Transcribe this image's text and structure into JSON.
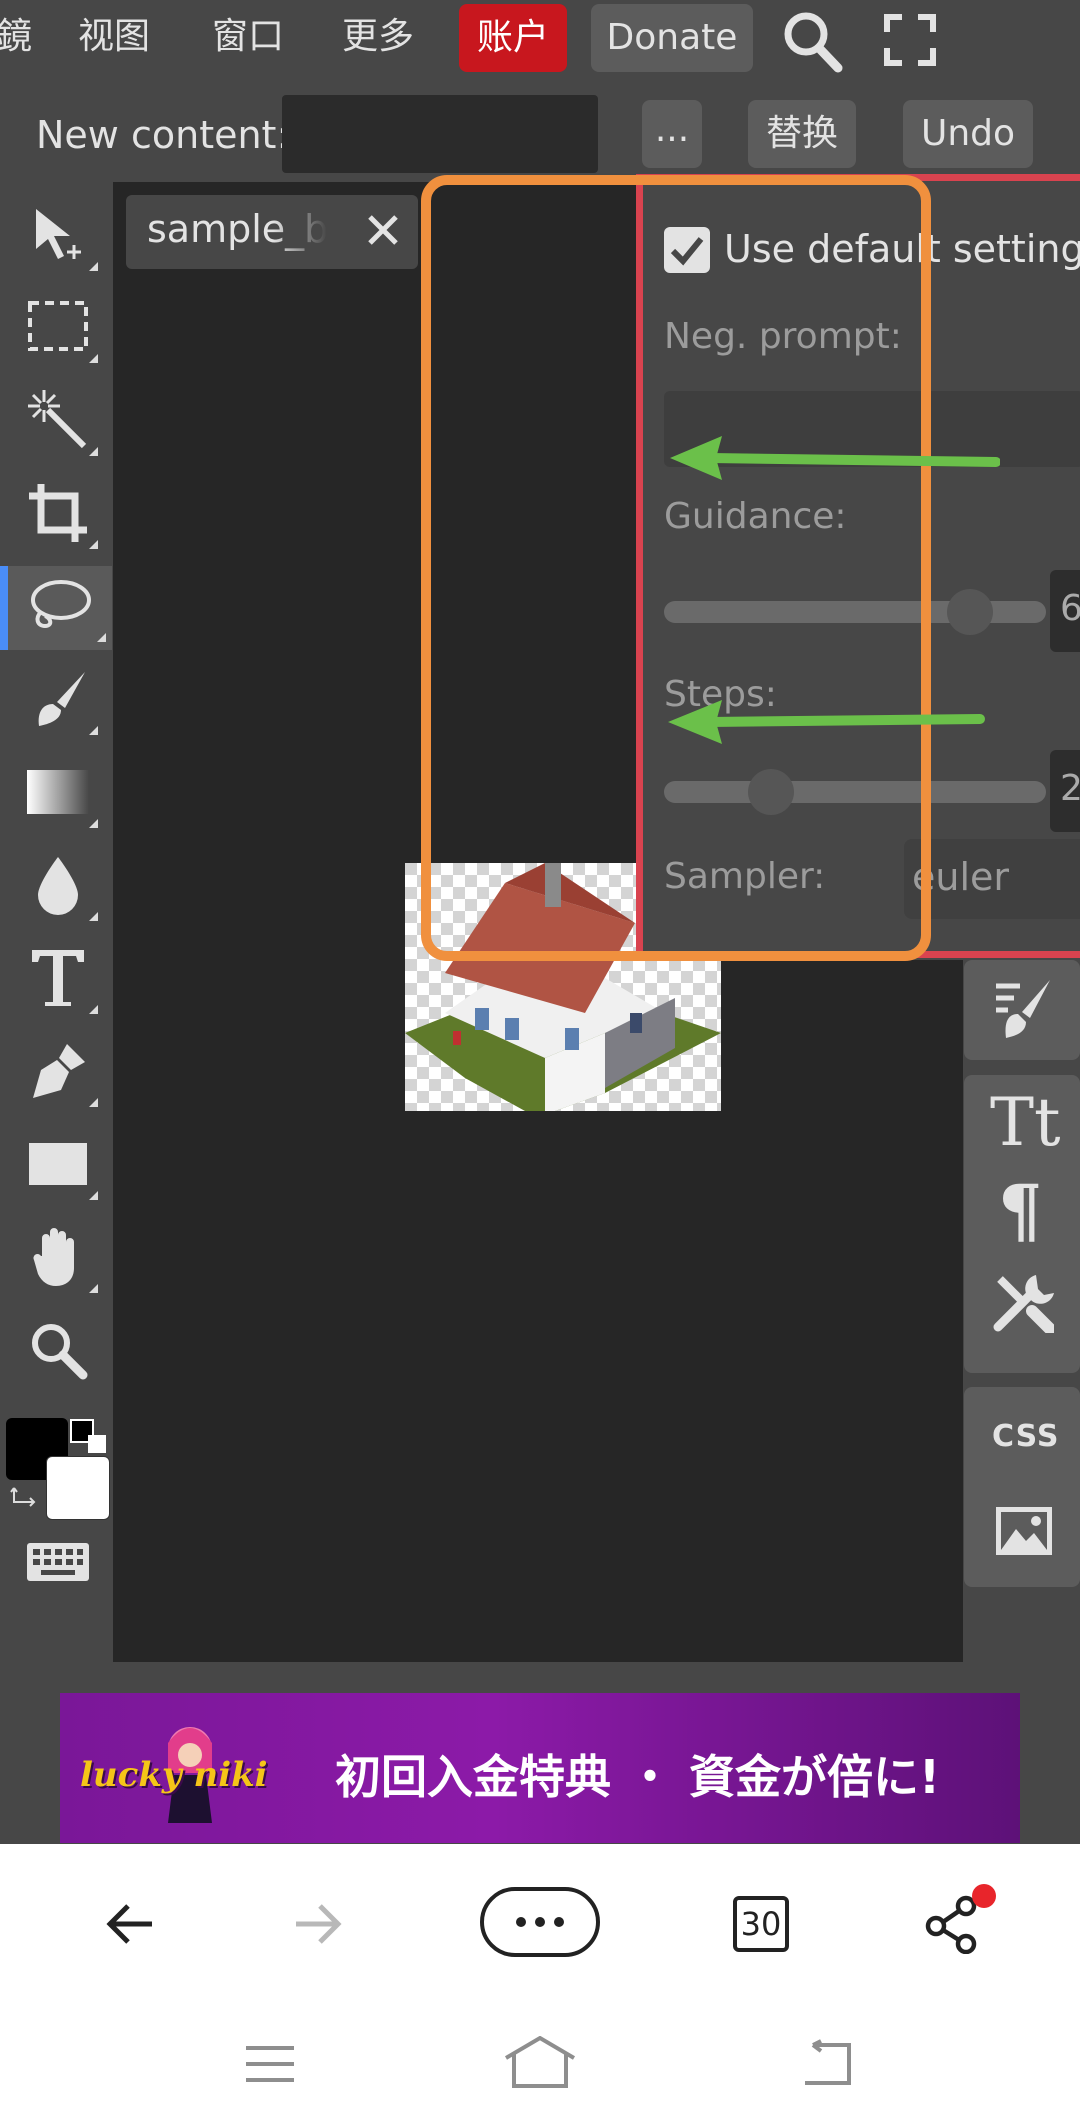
{
  "menu": {
    "items": [
      "鏡",
      "视图",
      "窗口",
      "更多"
    ],
    "account_label": "账户",
    "donate_label": "Donate"
  },
  "options_bar": {
    "new_content_label": "New content:",
    "new_content_value": "",
    "more_label": "...",
    "replace_label": "替换",
    "undo_label": "Undo"
  },
  "document": {
    "tab_name": "sample_b"
  },
  "settings_popup": {
    "use_default_label": "Use default settings",
    "use_default_checked": true,
    "neg_prompt_label": "Neg. prompt:",
    "neg_prompt_value": "",
    "guidance_label": "Guidance:",
    "guidance_value_partial": "6",
    "guidance_fill": 0.8,
    "steps_label": "Steps:",
    "steps_value_partial": "2",
    "steps_fill": 0.28,
    "sampler_label": "Sampler:",
    "sampler_value": "euler"
  },
  "right_panel": {
    "css_label": "CSS"
  },
  "ad": {
    "brand": "lucky niki",
    "text": "初回入金特典 ・ 資金が倍に!"
  },
  "browser": {
    "tabs_count": "30"
  },
  "colors": {
    "accent_blue": "#4a8df8",
    "account_red": "#c8171e",
    "annotation_orange": "#f0903e",
    "annotation_red": "#d9434f",
    "annotation_green": "#6bc04a"
  }
}
